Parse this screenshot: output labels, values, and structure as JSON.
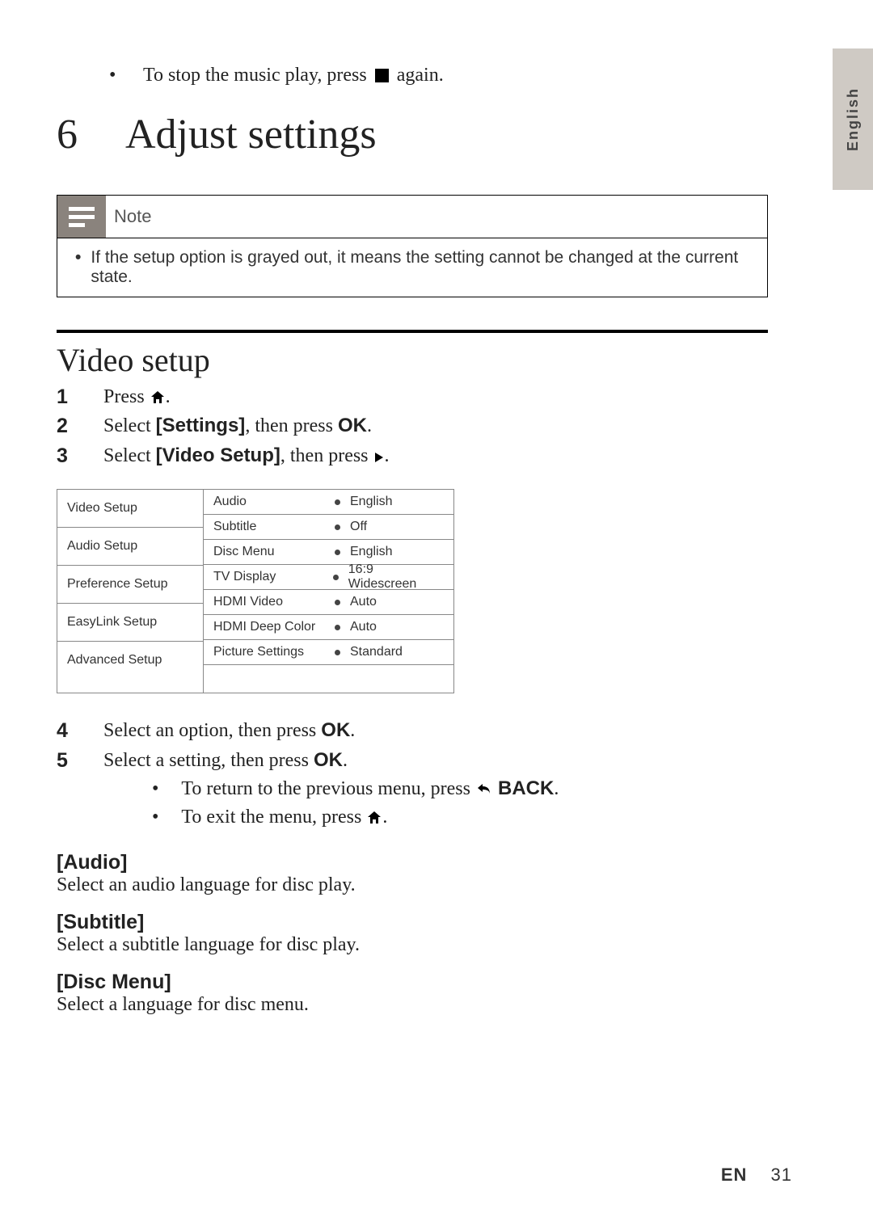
{
  "lang_tab": "English",
  "intro": {
    "text_before": "To stop the music play, press",
    "text_after": " again."
  },
  "chapter": {
    "num": "6",
    "title": "Adjust settings"
  },
  "note": {
    "title": "Note",
    "body": "If the setup option is grayed out, it means the setting cannot be changed at the current state."
  },
  "section_title": "Video setup",
  "steps": {
    "s1": "Press ",
    "s1_end": ".",
    "s2_a": "Select ",
    "s2_bold": "[Settings]",
    "s2_b": ", then press ",
    "s2_ok": "OK",
    "s2_c": ".",
    "s3_a": "Select ",
    "s3_bold": "[Video Setup]",
    "s3_b": ", then press ",
    "s3_c": ".",
    "s4_a": "Select an option, then press ",
    "s4_ok": "OK",
    "s4_b": ".",
    "s5_a": "Select a setting, then press ",
    "s5_ok": "OK",
    "s5_b": ".",
    "sub1_a": "To return to the previous menu, press ",
    "sub1_back": "BACK",
    "sub1_b": ".",
    "sub2_a": "To exit the menu, press ",
    "sub2_b": "."
  },
  "menu": {
    "left": [
      "Video Setup",
      "Audio Setup",
      "Preference Setup",
      "EasyLink Setup",
      "Advanced Setup"
    ],
    "right": [
      {
        "label": "Audio",
        "value": "English"
      },
      {
        "label": "Subtitle",
        "value": "Off"
      },
      {
        "label": "Disc Menu",
        "value": "English"
      },
      {
        "label": "TV Display",
        "value": "16:9 Widescreen"
      },
      {
        "label": "HDMI Video",
        "value": "Auto"
      },
      {
        "label": "HDMI Deep Color",
        "value": "Auto"
      },
      {
        "label": "Picture Settings",
        "value": "Standard"
      }
    ]
  },
  "options": [
    {
      "title": "[Audio]",
      "desc": "Select an audio language for disc play."
    },
    {
      "title": "[Subtitle]",
      "desc": "Select a subtitle language for disc play."
    },
    {
      "title": "[Disc Menu]",
      "desc": "Select a language for disc menu."
    }
  ],
  "footer": {
    "lang": "EN",
    "page": "31"
  }
}
